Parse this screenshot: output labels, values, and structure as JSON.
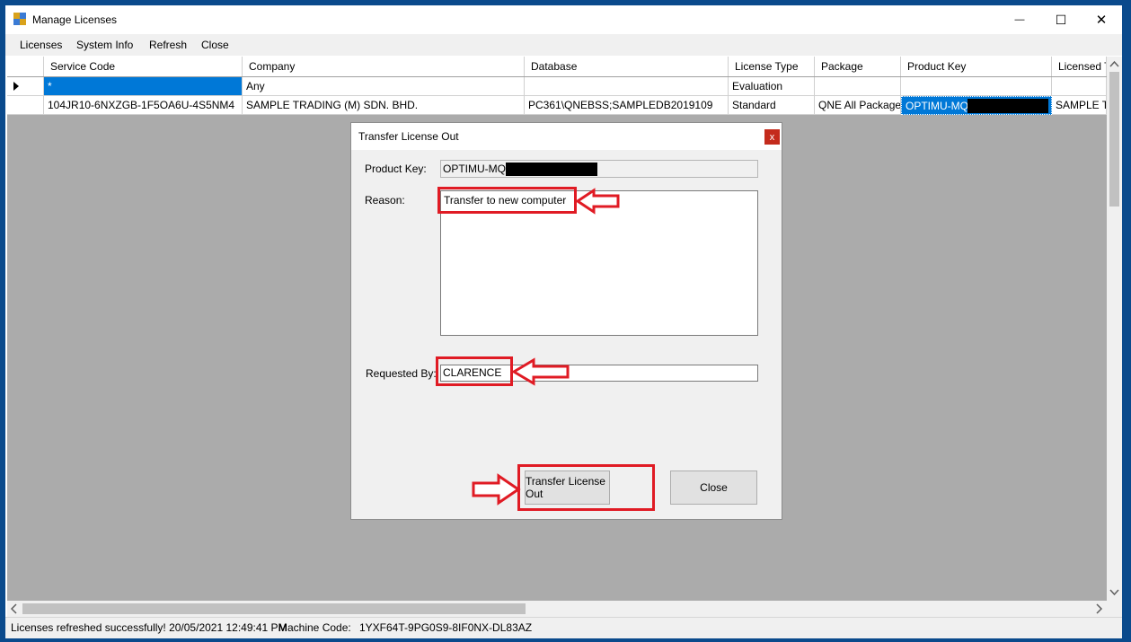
{
  "window": {
    "title": "Manage Licenses",
    "min_glyph": "—",
    "max_glyph": "☐",
    "close_glyph": "✕"
  },
  "menu": {
    "items": [
      "Licenses",
      "System Info",
      "Refresh",
      "Close"
    ]
  },
  "grid": {
    "columns": [
      "Service Code",
      "Company",
      "Database",
      "License Type",
      "Package",
      "Product Key",
      "Licensed T"
    ],
    "new_row": {
      "service_code": "*",
      "company": "Any",
      "database": "",
      "license_type": "Evaluation",
      "package": "",
      "product_key": "",
      "licensed_to": ""
    },
    "rows": [
      {
        "service_code": "104JR10-6NXZGB-1F5OA6U-4S5NM4",
        "company": "SAMPLE TRADING (M) SDN. BHD.",
        "database": "PC361\\QNEBSS;SAMPLEDB2019109",
        "license_type": "Standard",
        "package": "QNE All Packages",
        "product_key": "OPTIMU-MQN",
        "licensed_to": "SAMPLE TR"
      }
    ]
  },
  "dialog": {
    "title": "Transfer License Out",
    "close_glyph": "x",
    "product_key_label": "Product Key:",
    "product_key_value": "OPTIMU-MQN",
    "reason_label": "Reason:",
    "reason_value": "Transfer to new computer",
    "requested_by_label": "Requested By:",
    "requested_by_value": "CLARENCE",
    "transfer_button": "Transfer License Out",
    "close_button": "Close"
  },
  "status": {
    "message": "Licenses refreshed successfully! 20/05/2021 12:49:41 PM",
    "machine_code_label": "Machine Code:",
    "machine_code": "1YXF64T-9PG0S9-8IF0NX-DL83AZ"
  },
  "colors": {
    "annotation_red": "#e01b24",
    "selection_blue": "#0078d7",
    "desktop_blue": "#0a4a8c"
  }
}
